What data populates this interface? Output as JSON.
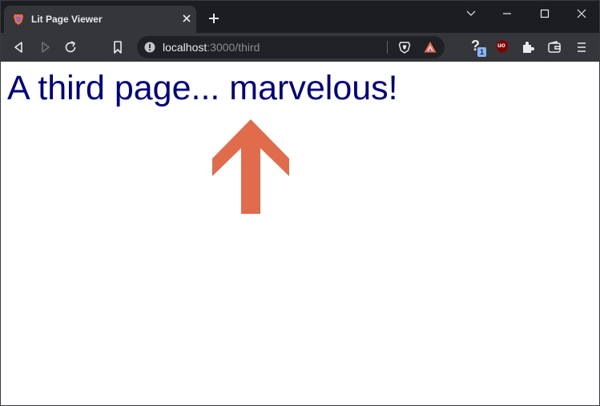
{
  "window": {
    "tab": {
      "title": "Lit Page Viewer",
      "favicon": "brave-lion-icon"
    },
    "controls": [
      "chevron-down-icon",
      "minimize-icon",
      "maximize-icon",
      "close-icon"
    ]
  },
  "toolbar": {
    "url_host": "localhost",
    "url_rest": ":3000/third",
    "icons": [
      "back-icon",
      "forward-icon",
      "reload-icon",
      "bookmark-icon",
      "site-info-icon",
      "brave-shields-icon",
      "brave-rewards-icon",
      "extension-help-icon",
      "ublock-icon",
      "extensions-icon",
      "wallet-icon",
      "menu-icon"
    ],
    "extension_badge": "1",
    "ublock_label": "uo"
  },
  "page": {
    "heading": "A third page... marvelous!"
  },
  "colors": {
    "heading": "#000080",
    "annotation_arrow": "#e06c4c"
  }
}
